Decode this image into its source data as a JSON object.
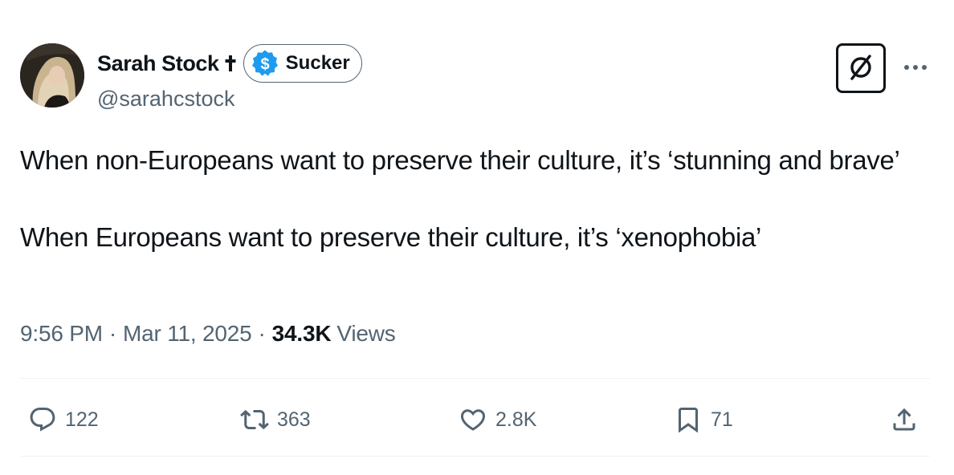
{
  "author": {
    "display_name": "Sarah Stock",
    "affiliation_icon": "cross-icon",
    "badge": {
      "icon": "dollar-circle-icon",
      "label": "Sucker",
      "icon_color": "#1d9bf0"
    },
    "handle": "@sarahcstock"
  },
  "header_actions": {
    "grok_icon": "slashed-circle-icon",
    "more_icon": "more-dots-icon"
  },
  "tweet": {
    "paragraphs": [
      "When non-Europeans want to preserve their culture, it’s ‘stunning and brave’",
      "When Europeans want to preserve their culture, it’s ‘xenophobia’"
    ],
    "time": "9:56 PM",
    "date": "Mar 11, 2025",
    "separator": "·",
    "views_count": "34.3K",
    "views_label": "Views"
  },
  "actions": {
    "reply": {
      "icon": "reply-icon",
      "count": "122"
    },
    "repost": {
      "icon": "repost-icon",
      "count": "363"
    },
    "like": {
      "icon": "heart-icon",
      "count": "2.8K"
    },
    "bookmark": {
      "icon": "bookmark-icon",
      "count": "71"
    },
    "share": {
      "icon": "share-icon"
    }
  },
  "colors": {
    "text_primary": "#0f1419",
    "text_secondary": "#536471",
    "divider": "#eff3f4",
    "accent": "#1d9bf0"
  }
}
